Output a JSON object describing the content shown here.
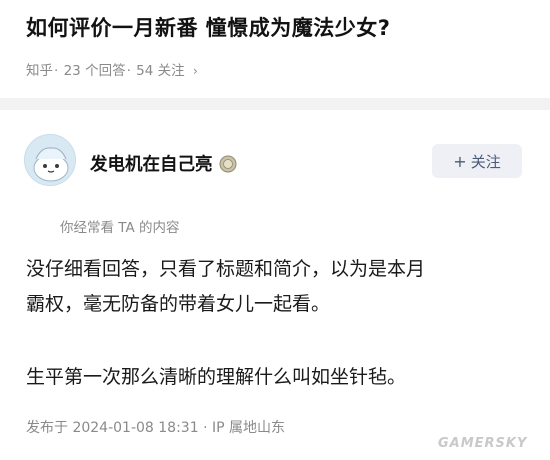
{
  "question": {
    "title": "如何评价一月新番 憧憬成为魔法少女?",
    "source": "知乎",
    "answers": "23 个回答",
    "followers": "54 关注",
    "chevron_icon": "chevron-right-icon"
  },
  "answer": {
    "author_name": "发电机在自己亮",
    "avatar_icon": "cartoon-avatar",
    "badge_icon": "medal-badge-icon",
    "follow_label": "关注",
    "follow_plus": "+",
    "seen_note": "你经常看 TA 的内容",
    "paragraphs": [
      "没仔细看回答，只看了标题和简介，以为是本月",
      "霸权，毫无防备的带着女儿一起看。",
      "生平第一次那么清晰的理解什么叫如坐针毡。"
    ],
    "published": "发布于 2024-01-08 18:31",
    "location": "IP 属地山东"
  },
  "watermark": "GAMERSKY",
  "colors": {
    "divider": "#f2f2f2",
    "follow_bg": "#eef0f5",
    "follow_text": "#4a5a7a",
    "muted": "#8a8a8a"
  }
}
